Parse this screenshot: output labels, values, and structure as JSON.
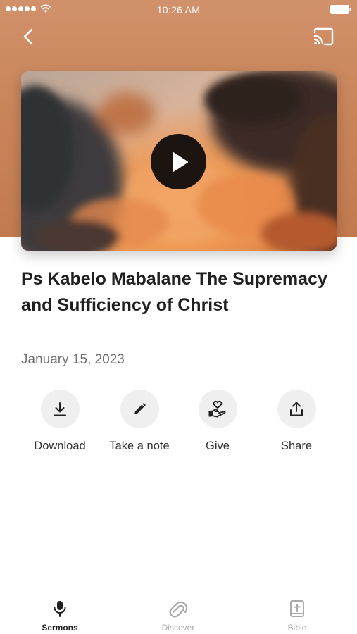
{
  "status_bar": {
    "time": "10:26 AM"
  },
  "sermon": {
    "title": "Ps Kabelo Mabalane The Supremacy and Sufficiency of Christ",
    "date": "January 15, 2023"
  },
  "actions": [
    {
      "label": "Download",
      "icon": "download-icon"
    },
    {
      "label": "Take a note",
      "icon": "pencil-icon"
    },
    {
      "label": "Give",
      "icon": "heart-hand-icon"
    },
    {
      "label": "Share",
      "icon": "share-icon"
    }
  ],
  "tabs": [
    {
      "label": "Sermons",
      "icon": "microphone-icon",
      "active": true
    },
    {
      "label": "Discover",
      "icon": "discover-icon",
      "active": false
    },
    {
      "label": "Bible",
      "icon": "bible-icon",
      "active": false
    }
  ],
  "colors": {
    "header_bg": "#c9855a",
    "active_tab": "#1f1f1f",
    "inactive_tab": "#aaaaaa",
    "action_circle": "#efefef"
  }
}
